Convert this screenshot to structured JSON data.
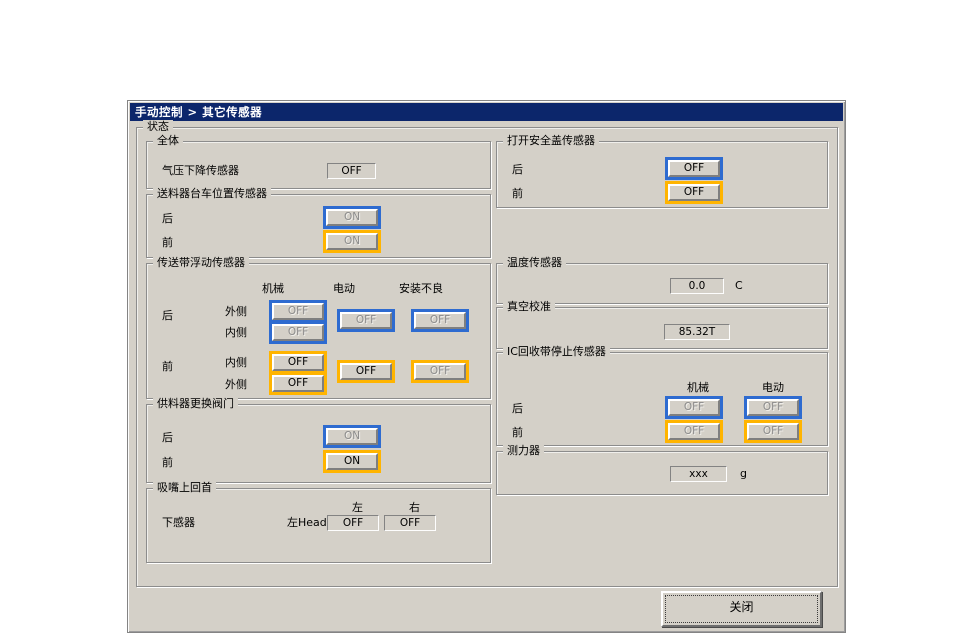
{
  "colors": {
    "titlebar": "#0c266b",
    "rear_accent": "#2e6bd0",
    "front_accent": "#ffb400"
  },
  "window": {
    "title": "手动控制 > 其它传感器"
  },
  "status": {
    "label": "状态"
  },
  "left": {
    "overall": {
      "title": "全体",
      "sensor_label": "气压下降传感器",
      "value": "OFF"
    },
    "feeder_cart": {
      "title": "送料器台车位置传感器",
      "rear_label": "后",
      "rear_value": "ON",
      "front_label": "前",
      "front_value": "ON"
    },
    "conveyor_float": {
      "title": "传送带浮动传感器",
      "col_mech": "机械",
      "col_elec": "电动",
      "col_fault": "安装不良",
      "rear_label": "后",
      "front_label": "前",
      "outer_label": "外侧",
      "inner_label": "内侧",
      "rear_mech_outer": "OFF",
      "rear_mech_inner": "OFF",
      "rear_elec": "OFF",
      "rear_fault": "OFF",
      "front_mech_inner": "OFF",
      "front_mech_outer": "OFF",
      "front_elec": "OFF",
      "front_fault": "OFF"
    },
    "feeder_valve": {
      "title": "供料器更换阀门",
      "rear_label": "后",
      "rear_value": "ON",
      "front_label": "前",
      "front_value": "ON"
    },
    "nozzle": {
      "title": "吸嘴上回首",
      "col_left": "左",
      "col_right": "右",
      "sensor_label": "下感器",
      "head_label": "左Head",
      "left_value": "OFF",
      "right_value": "OFF"
    }
  },
  "right": {
    "safety_cover": {
      "title": "打开安全盖传感器",
      "rear_label": "后",
      "rear_value": "OFF",
      "front_label": "前",
      "front_value": "OFF"
    },
    "temperature": {
      "title": "温度传感器",
      "value": "0.0",
      "unit": "C"
    },
    "vacuum": {
      "title": "真空校准",
      "value": "85.32T"
    },
    "ic_tape": {
      "title": "IC回收带停止传感器",
      "col_mech": "机械",
      "col_elec": "电动",
      "rear_label": "后",
      "front_label": "前",
      "rear_mech": "OFF",
      "rear_elec": "OFF",
      "front_mech": "OFF",
      "front_elec": "OFF"
    },
    "force_gauge": {
      "title": "测力器",
      "value": "xxx",
      "unit": "g"
    }
  },
  "footer": {
    "close_label": "关闭"
  }
}
